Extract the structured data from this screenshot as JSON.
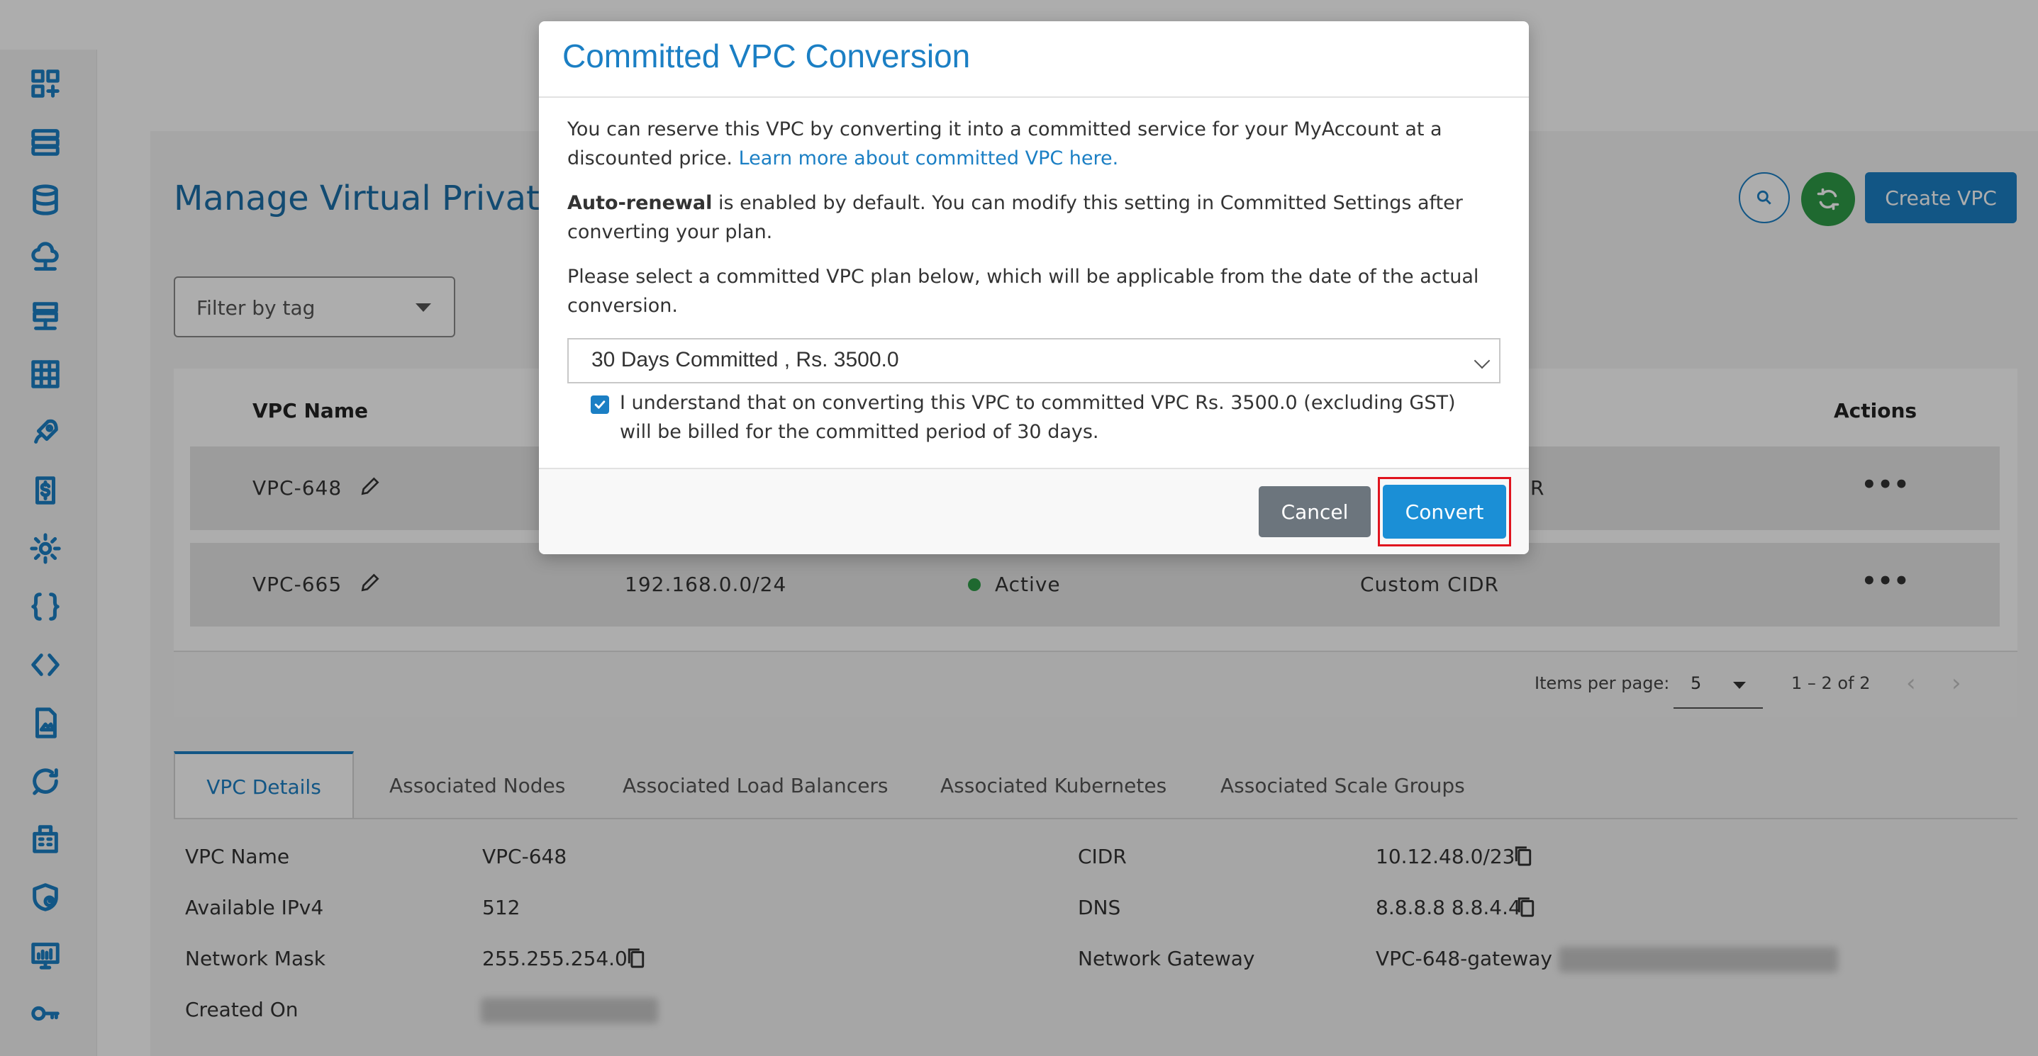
{
  "header": {
    "title": "Manage Virtual Private",
    "create_button": "Create VPC"
  },
  "sidebar": {
    "icons": [
      "dashboard-add-icon",
      "server-icon",
      "database-icon",
      "cloud-network-icon",
      "network-server-icon",
      "grid-icon",
      "rocket-icon",
      "billing-icon",
      "gear-icon",
      "braces-icon",
      "code-icon",
      "file-image-icon",
      "chat-refresh-icon",
      "building-icon",
      "shield-clock-icon",
      "monitor-chart-icon",
      "key-icon"
    ]
  },
  "filter": {
    "label": "Filter by tag"
  },
  "table": {
    "headers": {
      "name": "VPC Name",
      "actions": "Actions"
    },
    "rows": [
      {
        "name": "VPC-648",
        "cidr": "",
        "status": "",
        "type": "R",
        "actions": "•••"
      },
      {
        "name": "VPC-665",
        "cidr": "192.168.0.0/24",
        "status": "Active",
        "type": "Custom CIDR",
        "actions": "•••"
      }
    ]
  },
  "pagination": {
    "label": "Items per page:",
    "per_page": "5",
    "range": "1 – 2 of 2"
  },
  "tabs": [
    "VPC Details",
    "Associated Nodes",
    "Associated Load Balancers",
    "Associated Kubernetes",
    "Associated Scale Groups"
  ],
  "details": {
    "left": [
      {
        "label": "VPC Name",
        "value": "VPC-648"
      },
      {
        "label": "Available IPv4",
        "value": "512"
      },
      {
        "label": "Network Mask",
        "value": "255.255.254.0"
      },
      {
        "label": "Created On",
        "value": ""
      }
    ],
    "right": [
      {
        "label": "CIDR",
        "value": "10.12.48.0/23"
      },
      {
        "label": "DNS",
        "value": "8.8.8.8 8.8.4.4"
      },
      {
        "label": "Network Gateway",
        "value": "VPC-648-gateway"
      }
    ]
  },
  "modal": {
    "title": "Committed VPC Conversion",
    "intro": "You can reserve this VPC by converting it into a committed service for your MyAccount at a discounted price.",
    "learn_more": "Learn more about committed VPC here.",
    "auto_renewal_bold": "Auto-renewal",
    "auto_renewal_rest": " is enabled by default. You can modify this setting in Committed Settings after converting your plan.",
    "select_instruction": "Please select a committed VPC plan below, which will be applicable from the date of the actual conversion.",
    "plan_selected": "30 Days Committed , Rs. 3500.0",
    "acknowledge": "I understand that on converting this VPC to committed VPC Rs. 3500.0 (excluding GST) will be billed for the committed period of 30 days.",
    "acknowledge_checked": true,
    "cancel_label": "Cancel",
    "convert_label": "Convert"
  },
  "colors": {
    "accent": "#1b7fc4",
    "active_status": "#2e9b47",
    "highlight": "#e0141e"
  }
}
